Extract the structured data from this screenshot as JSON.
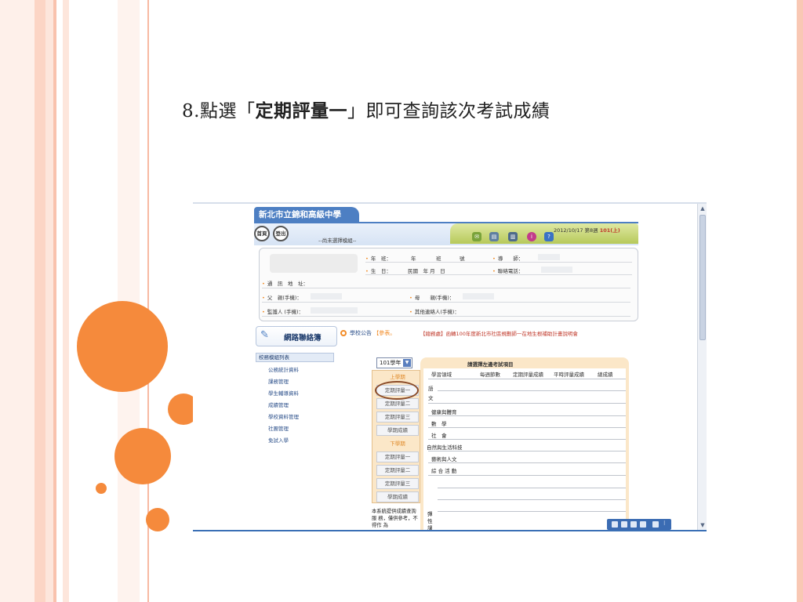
{
  "slide": {
    "title_prefix": "8.點選「",
    "title_highlight": "定期評量一",
    "title_suffix": "」即可查詢該次考試成績"
  },
  "colors": {
    "accent_orange": "#f58a3c",
    "stripe_light": "#fde7dd",
    "stripe_mid": "#f9c8b4",
    "header_blue": "#4d7fc3",
    "panel_beige": "#fbe7c8"
  },
  "app": {
    "school_name": "新北市立錦和高級中學",
    "home_button": "首頁",
    "logout_button": "登出",
    "module_status": "--尚未選擇模組--",
    "date_prefix": "2012/10/17 第8週 ",
    "date_term": "101(上)",
    "toolbar_icons": [
      "mail-icon",
      "print-icon",
      "printer-icon",
      "info-icon",
      "help-icon"
    ]
  },
  "student_info": {
    "class_label": "年　班：",
    "class_value_year": "年",
    "class_value_class": "班",
    "class_value_no": "號",
    "teacher_label": "導　　師：",
    "birthday_label": "生　日：",
    "birthday_value": "民國　年 月　日",
    "phone_label": "聯絡電話：",
    "address_label": "通　訊　地　址：",
    "father_label": "父　親(手機)：",
    "mother_label": "母　　親(手機)：",
    "guardian_label": "監護人 (手機)：",
    "other_label": "其他連絡人(手機)："
  },
  "board": {
    "logo_text": "網路聯絡簿",
    "announce_label": "學校公告",
    "announce_more": "【參表。",
    "news": "【總務處】函轉100年度新北市社區規劃師一在地生根補助計畫說明會"
  },
  "left_nav": {
    "title": "校務模組列表",
    "items": [
      "公務統計資料",
      "課務管理",
      "學生輔導資料",
      "成績管理",
      "學校資料管理",
      "社團管理",
      "免試入學"
    ]
  },
  "exam": {
    "year_select": "101學年",
    "buttons": [
      {
        "label": "上學期",
        "kind": "semester"
      },
      {
        "label": "定期評量一",
        "kind": "exam"
      },
      {
        "label": "定期評量二",
        "kind": "exam"
      },
      {
        "label": "定期評量三",
        "kind": "exam"
      },
      {
        "label": "學期成績",
        "kind": "exam"
      },
      {
        "label": "下學期",
        "kind": "semester"
      },
      {
        "label": "定期評量一",
        "kind": "exam"
      },
      {
        "label": "定期評量二",
        "kind": "exam"
      },
      {
        "label": "定期評量三",
        "kind": "exam"
      },
      {
        "label": "學期成績",
        "kind": "exam"
      }
    ],
    "note": "本系統提供成績查詢服 務，僅供參考，不得作 為"
  },
  "grades": {
    "header": "請選擇左邊考試項目",
    "columns": [
      "學習領域",
      "每週節數",
      "定期評量成績",
      "平時評量成績",
      "總成績"
    ],
    "subjects": [
      "文",
      "健康與體育",
      "數　學",
      "社　會",
      "自然與生活科技",
      "藝術與人文",
      "綜 合 活 動"
    ],
    "lang_top": "語",
    "bottom_vertical": "彈性課"
  }
}
